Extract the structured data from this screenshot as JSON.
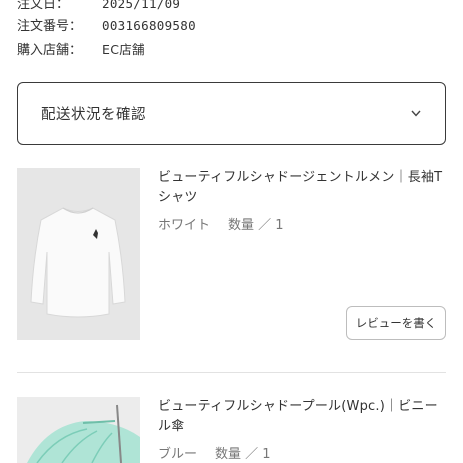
{
  "order_info": [
    {
      "label": "注文日：",
      "value": "2025/11/09"
    },
    {
      "label": "注文番号：",
      "value": "003166809580"
    },
    {
      "label": "購入店舗：",
      "value": "EC店舗"
    }
  ],
  "delivery": {
    "label": "配送状況を確認",
    "icon": "chevron-down-icon"
  },
  "products": [
    {
      "title": "ビューティフルシャドージェントルメン｜長袖Tシャツ",
      "color": "ホワイト",
      "qty_label": "数量 ／ 1",
      "review_label": "レビューを書く",
      "thumb_bg": "#e6e6e6"
    },
    {
      "title": "ビューティフルシャドープール(Wpc.)｜ビニール傘",
      "color": "ブルー",
      "qty_label": "数量 ／ 1",
      "thumb_bg": "#ececec"
    }
  ],
  "colors": {
    "border_dark": "#3a3a3a",
    "divider": "#e2e2e2",
    "meta_text": "#777777"
  }
}
